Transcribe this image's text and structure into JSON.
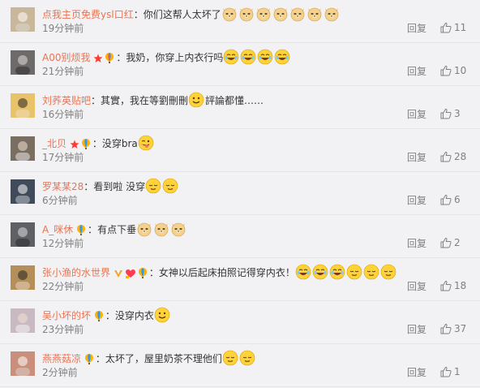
{
  "comments": [
    {
      "user": "点我主页免费ysl口红",
      "sep": "：",
      "badges": [],
      "text": "你们这帮人太坏了",
      "emojis": [
        "doge",
        "doge",
        "doge",
        "doge",
        "doge",
        "doge",
        "doge"
      ],
      "time": "19分钟前",
      "reply": "回复",
      "likes": "11",
      "avatar_bg": "#c9b79a"
    },
    {
      "user": "A00别烦我",
      "sep": "：",
      "badges": [
        "star-icon",
        "balloon-icon"
      ],
      "text": "我奶，你穿上内衣行吗",
      "emojis": [
        "laugh",
        "laugh",
        "laugh",
        "laugh"
      ],
      "time": "21分钟前",
      "reply": "回复",
      "likes": "10",
      "avatar_bg": "#6d6a69"
    },
    {
      "user": "刘荞英贴吧",
      "sep": "：",
      "badges": [],
      "text": "其實，我在等劉刪刪",
      "emojis": [
        "smile"
      ],
      "text_after": "評論都懂……",
      "time": "16分钟前",
      "reply": "回复",
      "likes": "3",
      "avatar_bg": "#e8c36a"
    },
    {
      "user": "_北贝",
      "sep": "：",
      "badges": [
        "star-icon",
        "balloon-icon"
      ],
      "text": "没穿bra",
      "emojis": [
        "tongue"
      ],
      "time": "17分钟前",
      "reply": "回复",
      "likes": "28",
      "avatar_bg": "#7a6e63"
    },
    {
      "user": "罗某某28",
      "sep": "：",
      "badges": [],
      "text": "看到啦 没穿",
      "emojis": [
        "relieved",
        "relieved"
      ],
      "time": "6分钟前",
      "reply": "回复",
      "likes": "6",
      "avatar_bg": "#3f4a5a"
    },
    {
      "user": "A_咪休",
      "sep": "：",
      "badges": [
        "balloon-icon"
      ],
      "text": "有点下垂",
      "emojis": [
        "doge",
        "doge",
        "doge"
      ],
      "time": "12分钟前",
      "reply": "回复",
      "likes": "2",
      "avatar_bg": "#5e6066"
    },
    {
      "user": "张小渔的水世界",
      "sep": "：",
      "badges": [
        "v-icon",
        "heart-icon",
        "balloon-icon"
      ],
      "text": "女神以后起床拍照记得穿内衣！",
      "emojis": [
        "laugh",
        "laugh",
        "laugh",
        "relieved",
        "relieved",
        "relieved"
      ],
      "time": "22分钟前",
      "reply": "回复",
      "likes": "18",
      "avatar_bg": "#b58f5a"
    },
    {
      "user": "吴小坏的坏",
      "sep": "：",
      "badges": [
        "balloon-icon"
      ],
      "text": "没穿内衣",
      "emojis": [
        "smile"
      ],
      "time": "23分钟前",
      "reply": "回复",
      "likes": "37",
      "avatar_bg": "#c9b9c2"
    },
    {
      "user": "燕燕菇凉",
      "sep": "：",
      "badges": [
        "balloon-icon"
      ],
      "text": "太坏了，屋里奶茶不理他们",
      "emojis": [
        "relieved",
        "relieved"
      ],
      "time": "2分钟前",
      "reply": "回复",
      "likes": "1",
      "avatar_bg": "#c98f7a"
    }
  ],
  "colors": {
    "username": "#eb7350",
    "meta": "#808080",
    "emoji_face": "#ffd23a"
  }
}
